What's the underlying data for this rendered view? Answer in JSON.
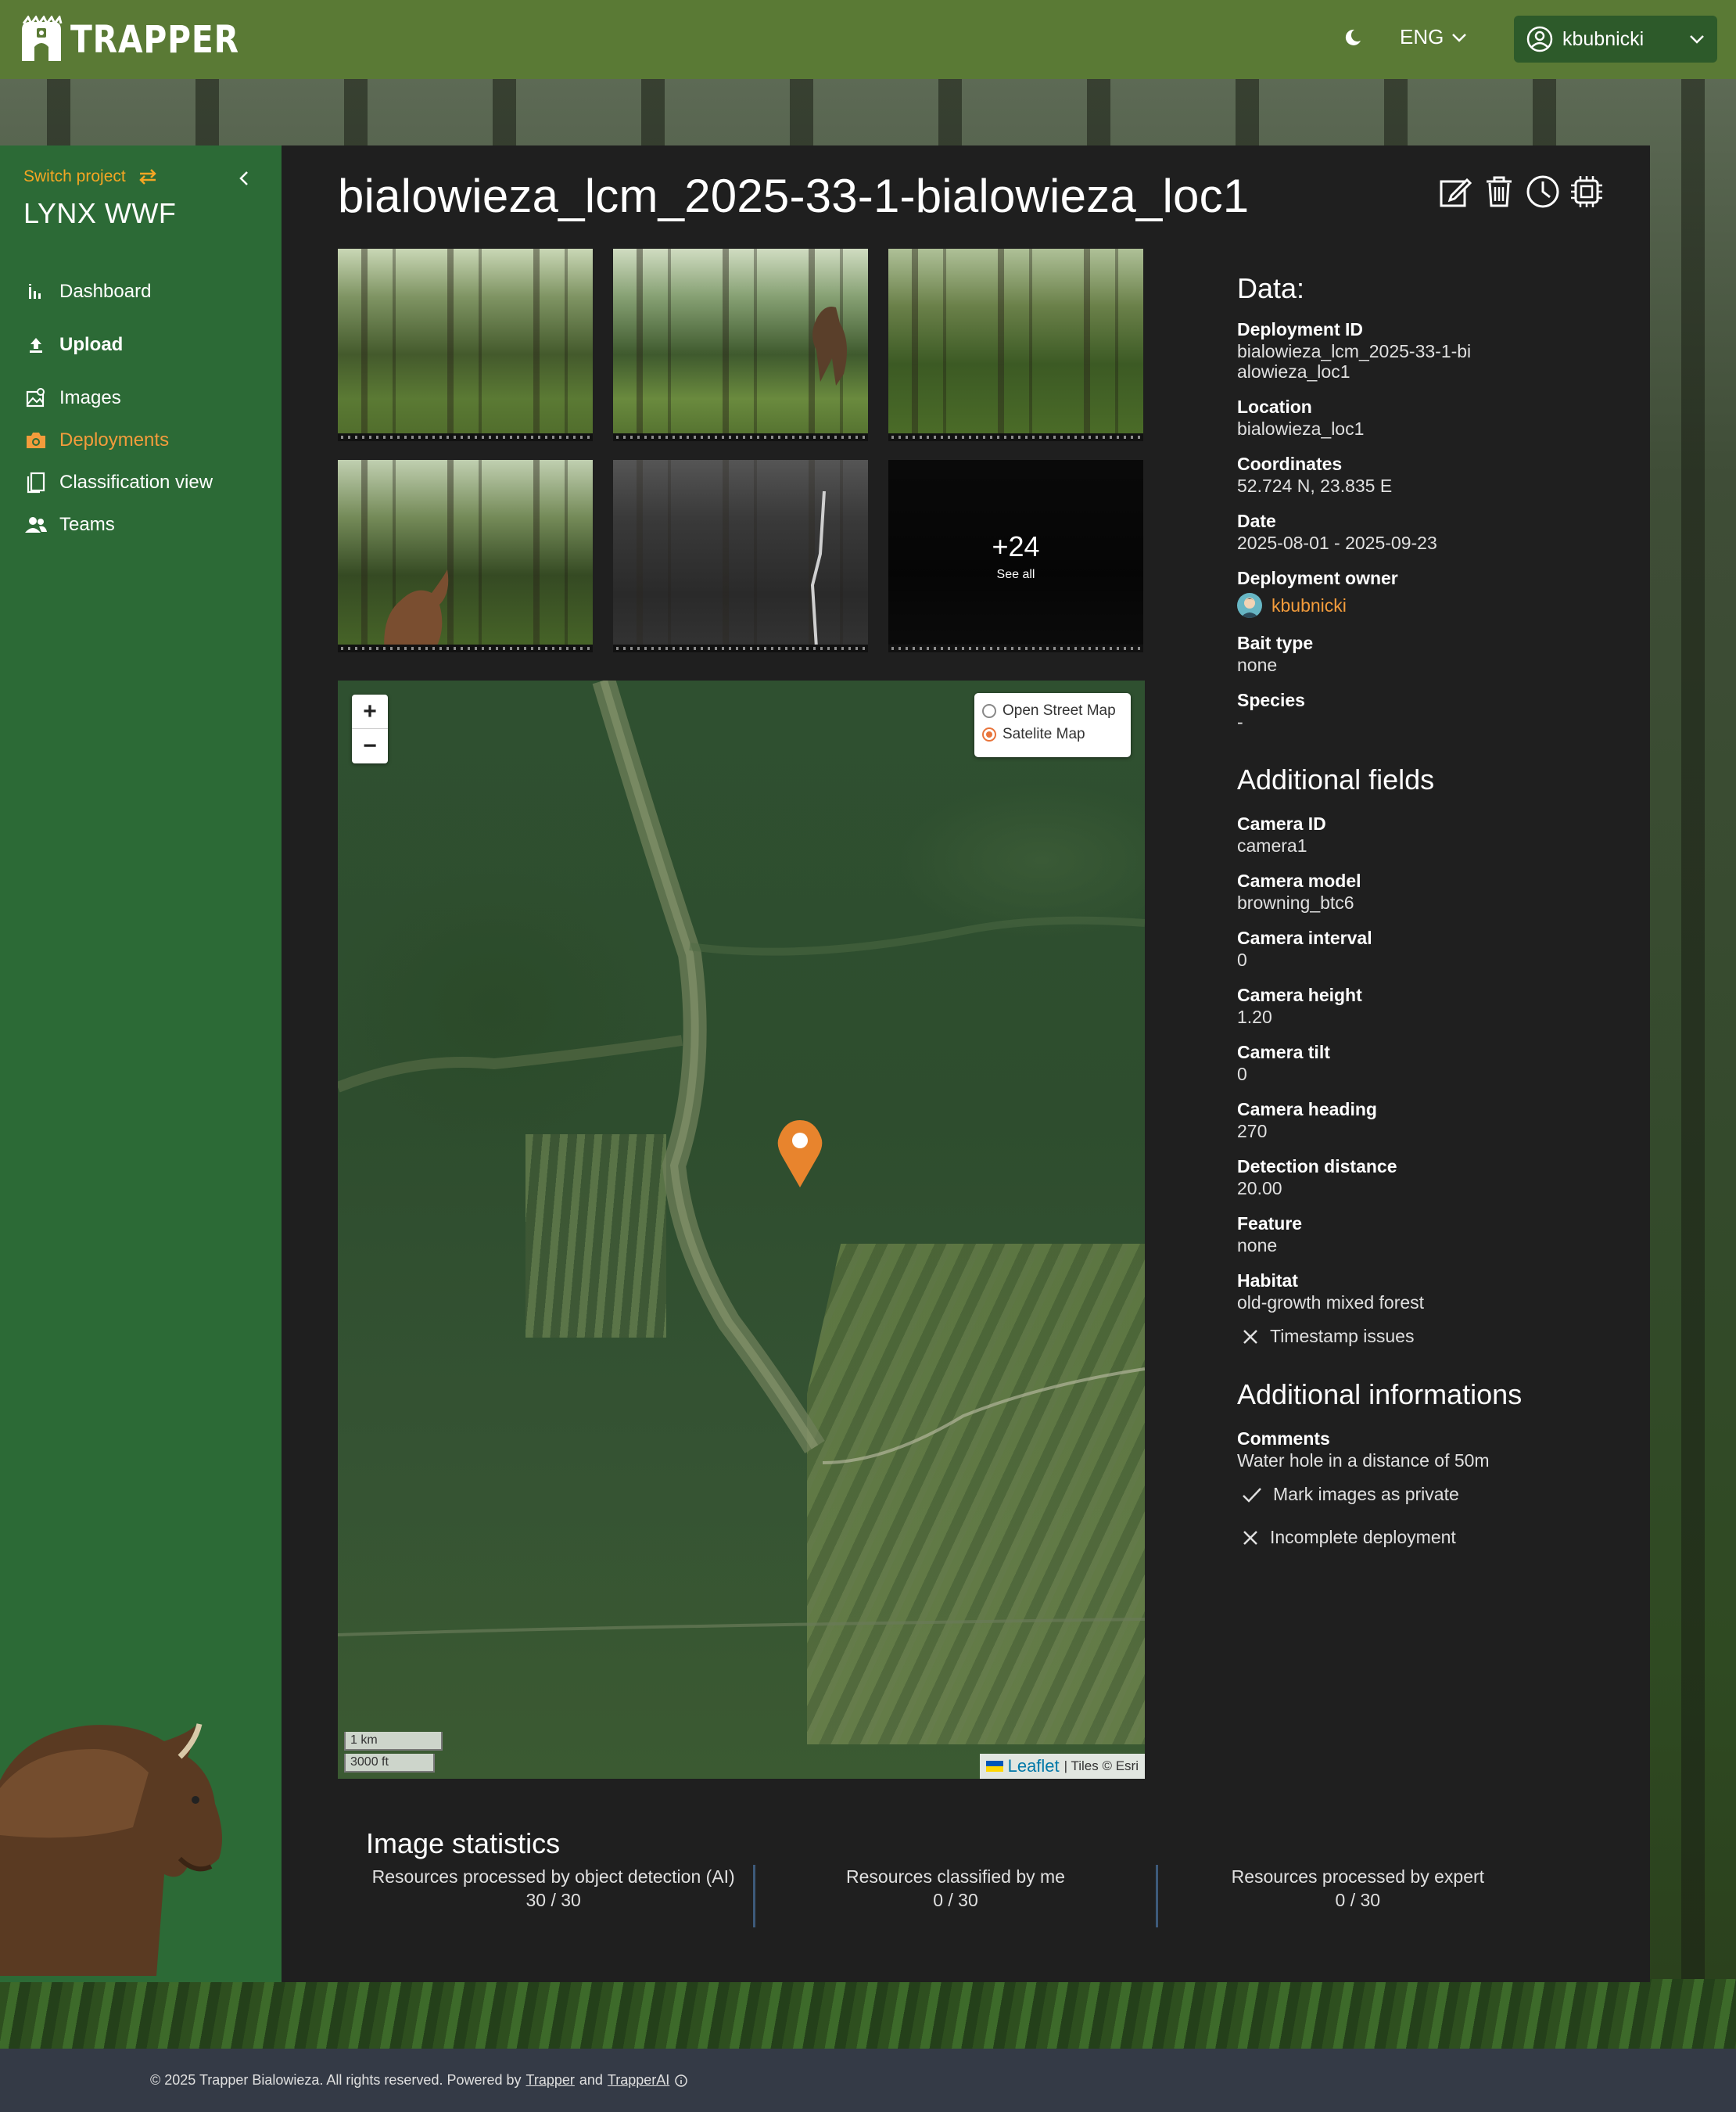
{
  "app": {
    "logo_text": "TRAPPER",
    "language": "ENG",
    "username": "kbubnicki"
  },
  "sidebar": {
    "switch_project_label": "Switch project",
    "project_name": "LYNX WWF",
    "items": [
      {
        "label": "Dashboard",
        "icon": "bar-chart-icon"
      },
      {
        "label": "Upload",
        "icon": "upload-icon"
      },
      {
        "label": "Images",
        "icon": "images-icon"
      },
      {
        "label": "Deployments",
        "icon": "camera-icon",
        "active": true
      },
      {
        "label": "Classification view",
        "icon": "classification-icon"
      },
      {
        "label": "Teams",
        "icon": "teams-icon"
      }
    ]
  },
  "page": {
    "title": "bialowieza_lcm_2025-33-1-bialowieza_loc1",
    "actions": [
      "edit-icon",
      "delete-icon",
      "history-icon",
      "processor-icon"
    ]
  },
  "gallery": {
    "more_count": "+24",
    "see_all_label": "See all"
  },
  "map": {
    "zoom_in": "+",
    "zoom_out": "−",
    "layers": [
      {
        "label": "Open Street Map",
        "selected": false
      },
      {
        "label": "Satelite Map",
        "selected": true
      }
    ],
    "scale_metric": "1 km",
    "scale_imperial": "3000 ft",
    "attribution_link": "Leaflet",
    "attribution_text": "| Tiles © Esri"
  },
  "data": {
    "heading": "Data:",
    "deployment_id_label": "Deployment ID",
    "deployment_id": "bialowieza_lcm_2025-33-1-bialowieza_loc1",
    "location_label": "Location",
    "location": "bialowieza_loc1",
    "coordinates_label": "Coordinates",
    "coordinates": "52.724 N, 23.835 E",
    "date_label": "Date",
    "date": "2025-08-01 - 2025-09-23",
    "owner_label": "Deployment owner",
    "owner": "kbubnicki",
    "bait_label": "Bait type",
    "bait": "none",
    "species_label": "Species",
    "species": "-"
  },
  "additional_fields": {
    "heading": "Additional fields",
    "camera_id_label": "Camera ID",
    "camera_id": "camera1",
    "camera_model_label": "Camera model",
    "camera_model": "browning_btc6",
    "camera_interval_label": "Camera interval",
    "camera_interval": "0",
    "camera_height_label": "Camera height",
    "camera_height": "1.20",
    "camera_tilt_label": "Camera tilt",
    "camera_tilt": "0",
    "camera_heading_label": "Camera heading",
    "camera_heading": "270",
    "detection_distance_label": "Detection distance",
    "detection_distance": "20.00",
    "feature_label": "Feature",
    "feature": "none",
    "habitat_label": "Habitat",
    "habitat": "old-growth mixed forest",
    "timestamp_issues": "Timestamp issues"
  },
  "additional_info": {
    "heading": "Additional informations",
    "comments_label": "Comments",
    "comments": "Water hole in a distance of 50m",
    "mark_private": "Mark images as private",
    "incomplete": "Incomplete deployment"
  },
  "stats": {
    "heading": "Image statistics",
    "items": [
      {
        "label": "Resources processed by object detection (AI)",
        "value": "30 / 30"
      },
      {
        "label": "Resources classified by me",
        "value": "0 / 30"
      },
      {
        "label": "Resources processed by expert",
        "value": "0 / 30"
      }
    ]
  },
  "footer": {
    "text": "© 2025 Trapper Bialowieza. All rights reserved. Powered by",
    "link1": "Trapper",
    "and": "and",
    "link2": "TrapperAI"
  },
  "colors": {
    "topbar": "#5a7a35",
    "sidebar": "#2c6a36",
    "accent": "#f39c3c",
    "panel": "#1f1f1f"
  }
}
